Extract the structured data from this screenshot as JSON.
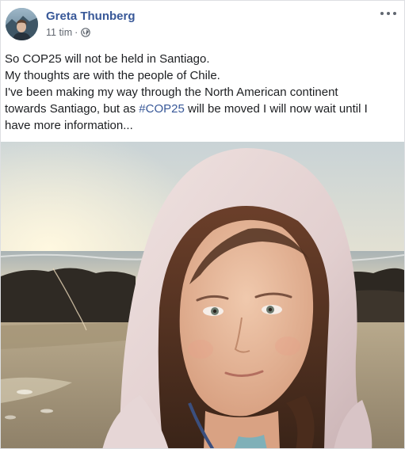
{
  "post": {
    "author": "Greta Thunberg",
    "time": "11 tim",
    "separator": "·",
    "privacy_icon": "globe-icon",
    "more_icon": "more-options-icon",
    "lines": [
      "So COP25 will not be held in Santiago.",
      "My thoughts are with the people of Chile.",
      "I've been making my way through the North American continent"
    ],
    "line4_before": "towards Santiago, but as ",
    "hashtag": "#COP25",
    "line4_after": " will be moved I will now wait until I",
    "line5": "have more information...",
    "photo": "selfie-photo"
  },
  "colors": {
    "link": "#385898",
    "meta": "#616770",
    "text": "#1c1e21"
  }
}
